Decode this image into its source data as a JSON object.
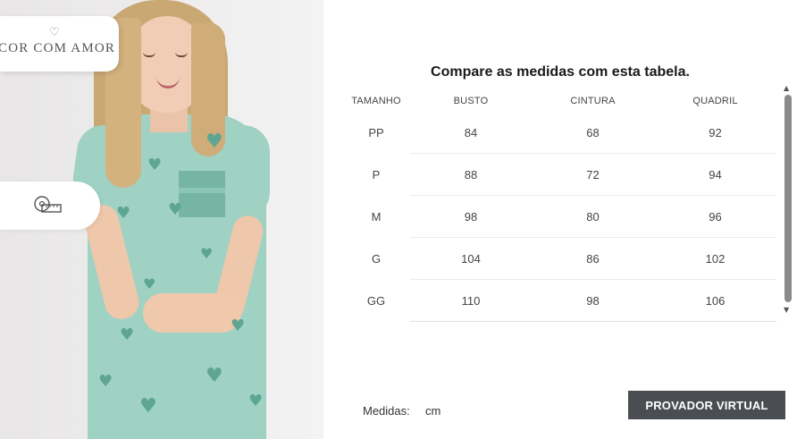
{
  "brand": {
    "name": "COR COM AMOR",
    "icon": "heart-icon"
  },
  "measure_tab": {
    "icon": "measuring-tape-icon"
  },
  "size_table": {
    "title": "Compare as medidas com esta tabela.",
    "headers": [
      "TAMANHO",
      "BUSTO",
      "CINTURA",
      "QUADRIL"
    ],
    "rows": [
      [
        "PP",
        "84",
        "68",
        "92"
      ],
      [
        "P",
        "88",
        "72",
        "94"
      ],
      [
        "M",
        "98",
        "80",
        "96"
      ],
      [
        "G",
        "104",
        "86",
        "102"
      ],
      [
        "GG",
        "110",
        "98",
        "106"
      ]
    ]
  },
  "units": {
    "label": "Medidas:",
    "value": "cm"
  },
  "button": {
    "label": "PROVADOR VIRTUAL"
  },
  "colors": {
    "button_bg": "#4a4d52",
    "dress": "#9fd2c3"
  }
}
